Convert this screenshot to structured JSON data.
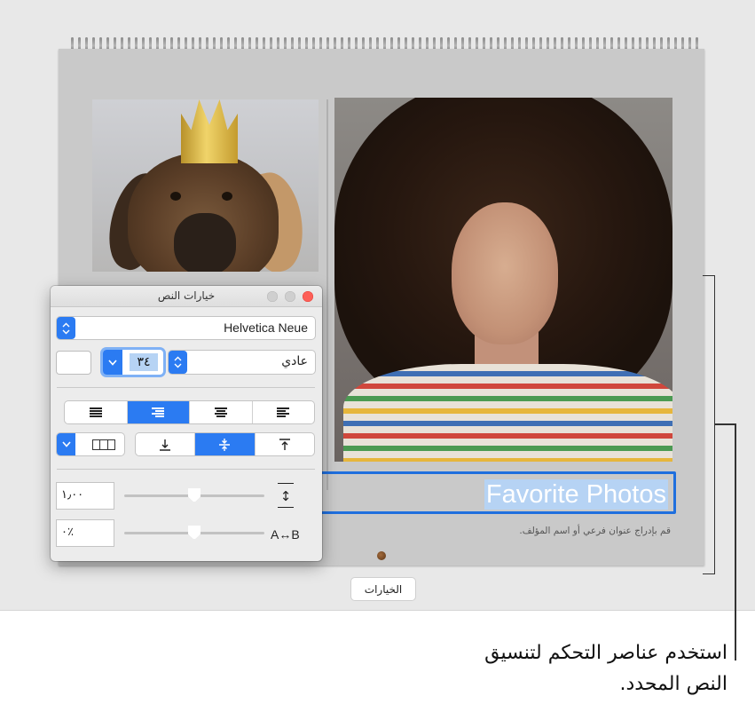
{
  "calendar": {
    "title": "Favorite Photos",
    "subtitle_placeholder": "قم بإدراج عنوان فرعي أو اسم المؤلف."
  },
  "options_button": {
    "label": "الخيارات"
  },
  "callout": {
    "text_line1": "استخدم عناصر التحكم لتنسيق",
    "text_line2": "النص المحدد."
  },
  "text_panel": {
    "title": "خيارات النص",
    "font_family": "Helvetica Neue",
    "font_size": "٣٤",
    "font_style": "عادي",
    "line_spacing": "١٫٠٠",
    "character_spacing": "٪٠",
    "character_spacing_icon_label": "A↔B",
    "alignment_selected": "right",
    "vertical_alignment_selected": "middle",
    "accent_color": "#2b7bf2",
    "close_button_color": "#fd5f57"
  },
  "selection_color": "#b6d3f4",
  "selection_border_color": "#1f6fde"
}
